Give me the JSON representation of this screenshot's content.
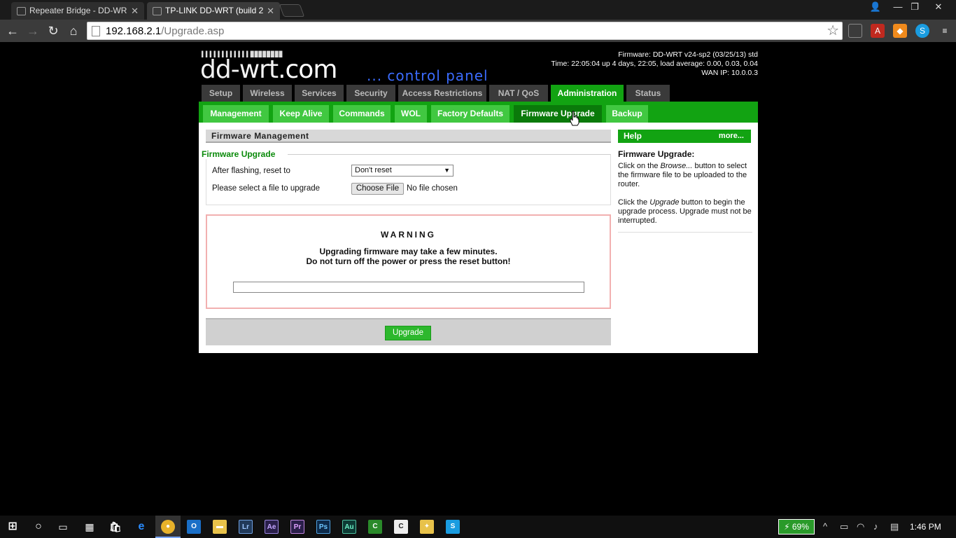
{
  "browser": {
    "tabs": [
      {
        "title": "Repeater Bridge - DD-WR",
        "active": false
      },
      {
        "title": "TP-LINK DD-WRT (build 2",
        "active": true
      }
    ],
    "url_host": "192.168.2.1",
    "url_path": "/Upgrade.asp",
    "window_controls": [
      "minimize-icon",
      "restore-icon",
      "close-icon"
    ]
  },
  "header": {
    "logo_bars": "▌▌▌▌▌▌▌▌▌▌▌▌████████",
    "logo_text": "dd-wrt",
    "logo_tld": ".com",
    "panel_text": "... control panel",
    "firmware": "Firmware: DD-WRT v24-sp2 (03/25/13) std",
    "time": "Time: 22:05:04 up 4 days, 22:05, load average: 0.00, 0.03, 0.04",
    "wan_ip": "WAN IP: 10.0.0.3"
  },
  "main_tabs": [
    "Setup",
    "Wireless",
    "Services",
    "Security",
    "Access Restrictions",
    "NAT / QoS",
    "Administration",
    "Status"
  ],
  "main_tab_selected": "Administration",
  "sub_tabs": [
    "Management",
    "Keep Alive",
    "Commands",
    "WOL",
    "Factory Defaults",
    "Firmware Upgrade",
    "Backup"
  ],
  "sub_tab_selected": "Firmware Upgrade",
  "firmware_section": {
    "header": "Firmware Management",
    "legend": "Firmware Upgrade",
    "reset_label": "After flashing, reset to",
    "reset_value": "Don't reset",
    "file_label": "Please select a file to upgrade",
    "choose_file": "Choose File",
    "no_file": "No file chosen"
  },
  "warning": {
    "title": "WARNING",
    "line1": "Upgrading firmware may take a few minutes.",
    "line2": "Do not turn off the power or press the reset button!"
  },
  "upgrade_button": "Upgrade",
  "help": {
    "header": "Help",
    "more": "more...",
    "title": "Firmware Upgrade:",
    "p1_a": "Click on the ",
    "p1_em": "Browse...",
    "p1_b": " button to select the firmware file to be uploaded to the router.",
    "p2_a": "Click the ",
    "p2_em": "Upgrade",
    "p2_b": " button to begin the upgrade process. Upgrade must not be interrupted."
  },
  "taskbar": {
    "battery": "69%",
    "clock": "1:46 PM",
    "apps": [
      "start-icon",
      "search-icon",
      "task-view-icon",
      "calculator-icon",
      "store-icon",
      "edge-icon",
      "chrome-icon",
      "outlook-icon",
      "explorer-icon",
      "lightroom-icon",
      "after-effects-icon",
      "premiere-icon",
      "photoshop-icon",
      "audition-icon",
      "camtasia-icon",
      "camtasia-recorder-icon",
      "people-icon",
      "skype-icon"
    ]
  }
}
